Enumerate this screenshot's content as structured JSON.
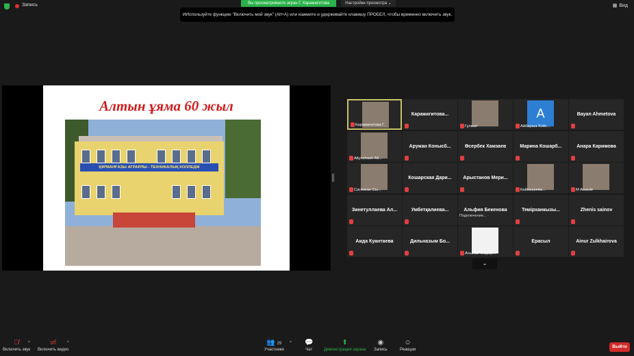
{
  "topbar": {
    "recording": "Запись",
    "viewing": "Вы просматриваете экран Г. Каражигитова",
    "view_options": "Настройки просмотра ⌄",
    "view_button": "Вид"
  },
  "tooltip": "ИИспользуйте функцию \"Включить мой звук\" (Alt+A) или нажмите и удерживайте клавишу ПРОБЕЛ, чтобы временно включить звук.",
  "slide": {
    "title": "Алтын ұяма 60 жыл",
    "sign": "ҚҰРМАНҒАЗЫ АГРАРЛЫ - ТЕХНИКАЛЫҚ КОЛЛЕДЖ"
  },
  "participants": [
    {
      "label": "Каражигитова Г.",
      "video": true
    },
    {
      "name": "Каражигитова..."
    },
    {
      "label": "Гулжат",
      "video": true
    },
    {
      "label": "Айбарша Койс...",
      "video": true,
      "letter": "A"
    },
    {
      "name": "Bayan Ahmetova"
    },
    {
      "label": "Altynshash Ali...",
      "video": true
    },
    {
      "name": "Аружан Конысб..."
    },
    {
      "name": "Өсербек Хамзаев"
    },
    {
      "name": "Марина Кошарб..."
    },
    {
      "name": "Анара Каримова"
    },
    {
      "label": "Сагинкан Сы...",
      "video": true
    },
    {
      "name": "Кошарская Дари..."
    },
    {
      "name": "Арыстанов Мери..."
    },
    {
      "label": "Каймышева...",
      "video": true
    },
    {
      "label": "M Aisaule",
      "video": true
    },
    {
      "name": "Зинетуллаева Ал..."
    },
    {
      "name": "Умбетқалиева..."
    },
    {
      "name": "Альфия Бекенова",
      "status": "Подключение... ·"
    },
    {
      "name": "Темірханкызы..."
    },
    {
      "name": "Zhenis sainov"
    },
    {
      "name": "Аида Куантаева"
    },
    {
      "name": "Дильназым Бо..."
    },
    {
      "label": "Асылай Садыр...",
      "video": true,
      "white": true
    },
    {
      "name": "Ерасыл"
    },
    {
      "name": "Ainur Zulkhairova"
    }
  ],
  "toolbar": {
    "mute": "Включить звук",
    "video": "Включить видео",
    "participants": "Участники",
    "participants_count": "29",
    "chat": "Чат",
    "share": "Демонстрация экрана",
    "record": "Запись",
    "reactions": "Реакции",
    "leave": "Выйти"
  }
}
